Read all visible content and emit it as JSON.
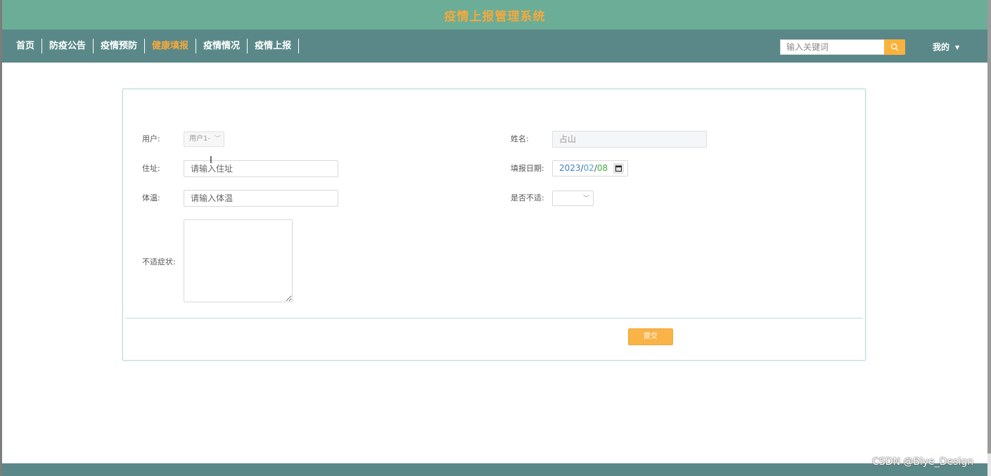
{
  "header": {
    "title": "疫情上报管理系统"
  },
  "nav": {
    "items": [
      {
        "label": "首页"
      },
      {
        "label": "防疫公告"
      },
      {
        "label": "疫情预防"
      },
      {
        "label": "健康填报",
        "active": true
      },
      {
        "label": "疫情情况"
      },
      {
        "label": "疫情上报"
      }
    ],
    "search_placeholder": "输入关键词",
    "user_menu": "我的"
  },
  "form": {
    "user_label": "用户:",
    "user_value": "用户1-",
    "name_label": "姓名:",
    "name_value": "占山",
    "address_label": "住址:",
    "address_placeholder": "请输入住址",
    "date_label": "填报日期:",
    "date_year": "2023",
    "date_month": "02",
    "date_day": "08",
    "temp_label": "体温:",
    "temp_placeholder": "请输入体温",
    "unwell_label": "是否不适:",
    "unwell_value": "",
    "symptoms_label": "不适症状:",
    "submit_label": "提交"
  },
  "watermark": "CSDN @Biye_Design",
  "colors": {
    "header_bg": "#6cad98",
    "nav_bg": "#5a8888",
    "accent": "#f4a93c"
  }
}
